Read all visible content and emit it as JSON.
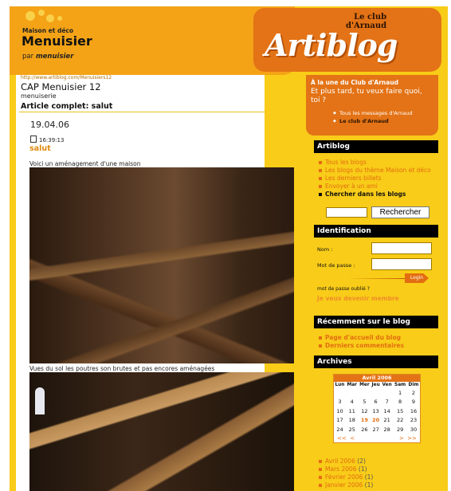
{
  "header": {
    "category": "Maison et déco",
    "title": "Menuisier",
    "by_prefix": "par",
    "by_author": "menuisier",
    "logo_text": "Artiblog",
    "logo_club_line1": "Le club",
    "logo_club_line2": "d'Arnaud"
  },
  "article": {
    "url": "http://www.artiblog.com/Menuisiers12",
    "blog_title": "CAP Menuisier 12",
    "blog_subtitle": "menuiserie",
    "heading": "Article complet: salut",
    "date": "19.04.06",
    "time": "16:39:13",
    "post_title": "salut",
    "caption1": "Voici un aménagement d'une maison",
    "caption2": "Vues du sol les poutres son brutes et pas encores aménagées"
  },
  "promo": {
    "kicker": "À la une du Club d'Arnaud",
    "text": "Et plus tard, tu veux faire quoi, toi ?",
    "link1": "Tous les messages d'Arnaud",
    "link2": "Le club d'Arnaud"
  },
  "artiblog": {
    "heading": "Artiblog",
    "items": [
      "Tous les blogs",
      "Les blogs du thème Maison et déco",
      "Les derniers billets",
      "Envoyer à un ami",
      "Chercher dans les blogs"
    ],
    "search_button": "Rechercher"
  },
  "identification": {
    "heading": "Identification",
    "name_label": "Nom :",
    "password_label": "Mot de passe :",
    "login_button": "Login",
    "forgot": "mot de passe oublié ?",
    "become_member": "Je veux devenir membre"
  },
  "recent": {
    "heading": "Récemment sur le blog",
    "items": [
      "Page d'accueil du blog",
      "Derniers commentaires"
    ]
  },
  "archives": {
    "heading": "Archives",
    "calendar": {
      "month": "Avril 2006",
      "days": [
        "Lun",
        "Mar",
        "Mer",
        "Jeu",
        "Ven",
        "Sam",
        "Dim"
      ],
      "weeks": [
        [
          "",
          "",
          "",
          "",
          "",
          "1",
          "2"
        ],
        [
          "3",
          "4",
          "5",
          "6",
          "7",
          "8",
          "9"
        ],
        [
          "10",
          "11",
          "12",
          "13",
          "14",
          "15",
          "16"
        ],
        [
          "17",
          "18",
          "19",
          "20",
          "21",
          "22",
          "23"
        ],
        [
          "24",
          "25",
          "26",
          "27",
          "28",
          "29",
          "30"
        ]
      ],
      "highlighted": [
        "19",
        "20"
      ],
      "nav_prev_year": "<<",
      "nav_prev": "<",
      "nav_next": ">",
      "nav_next_year": ">>"
    },
    "months": [
      {
        "label": "Avril 2006",
        "count": "(2)"
      },
      {
        "label": "Mars 2006",
        "count": "(1)"
      },
      {
        "label": "Février 2006",
        "count": "(1)"
      },
      {
        "label": "Janvier 2006",
        "count": "(1)"
      }
    ]
  },
  "colors": {
    "background_yellow": "#f8cc18",
    "header_orange": "#f4a316",
    "accent_orange": "#e37316",
    "link_orange": "#e36d10"
  }
}
